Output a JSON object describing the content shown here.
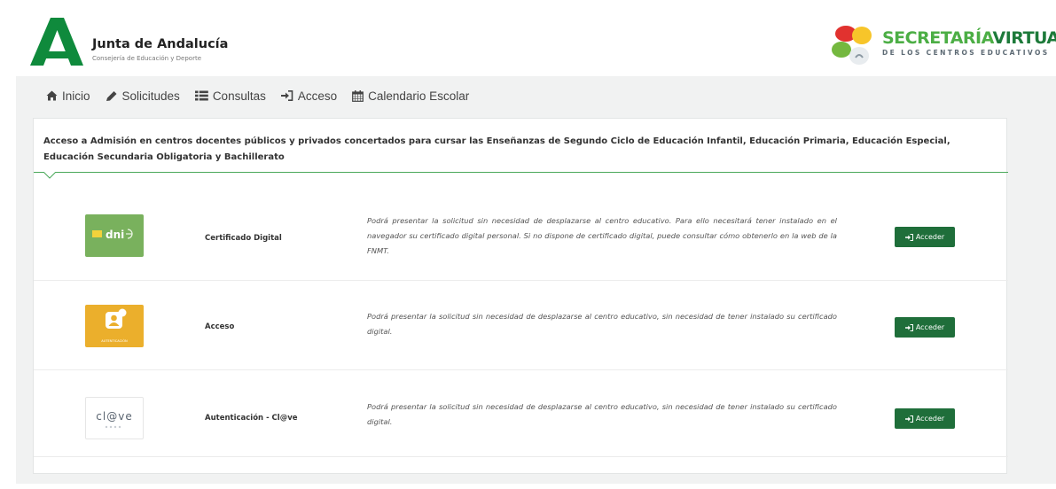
{
  "header": {
    "brand_title": "Junta de Andalucía",
    "brand_subtitle": "Consejería de Educación y Deporte",
    "sv_title_part1": "SECRETARÍA",
    "sv_title_part2": "VIRTUAL",
    "sv_subtitle": "DE LOS CENTROS EDUCATIVOS"
  },
  "nav": {
    "items": [
      {
        "label": "Inicio",
        "icon": "home-icon"
      },
      {
        "label": "Solicitudes",
        "icon": "pencil-icon"
      },
      {
        "label": "Consultas",
        "icon": "list-icon"
      },
      {
        "label": "Acceso",
        "icon": "sign-in-icon"
      },
      {
        "label": "Calendario Escolar",
        "icon": "calendar-icon"
      }
    ]
  },
  "card": {
    "title": "Acceso a Admisión en centros docentes públicos y privados concertados para cursar las Enseñanzas de Segundo Ciclo de Educación Infantil, Educación Primaria, Educación Especial, Educación Secundaria Obligatoria y Bachillerato"
  },
  "methods": [
    {
      "name": "Certificado Digital",
      "logo_text": "dni",
      "description": "Podrá presentar la solicitud sin necesidad de desplazarse al centro educativo. Para ello necesitará tener instalado en el navegador su certificado digital personal. Si no dispone de certificado digital, puede consultar cómo obtenerlo en la web de la FNMT.",
      "button_label": "Acceder"
    },
    {
      "name": "Acceso",
      "logo_text": "AUTENTICACIÓN",
      "description": "Podrá presentar la solicitud sin necesidad de desplazarse al centro educativo, sin necesidad de tener instalado su certificado digital.",
      "button_label": "Acceder"
    },
    {
      "name": "Autenticación - Cl@ve",
      "logo_text": "cl@ve",
      "description": "Podrá presentar la solicitud sin necesidad de desplazarse al centro educativo, sin necesidad de tener instalado su certificado digital.",
      "button_label": "Acceder"
    }
  ],
  "colors": {
    "brand_green": "#1f6e3a",
    "accent_green": "#4cae45",
    "dni_green": "#79b15d",
    "auth_orange": "#ebaf2c"
  }
}
